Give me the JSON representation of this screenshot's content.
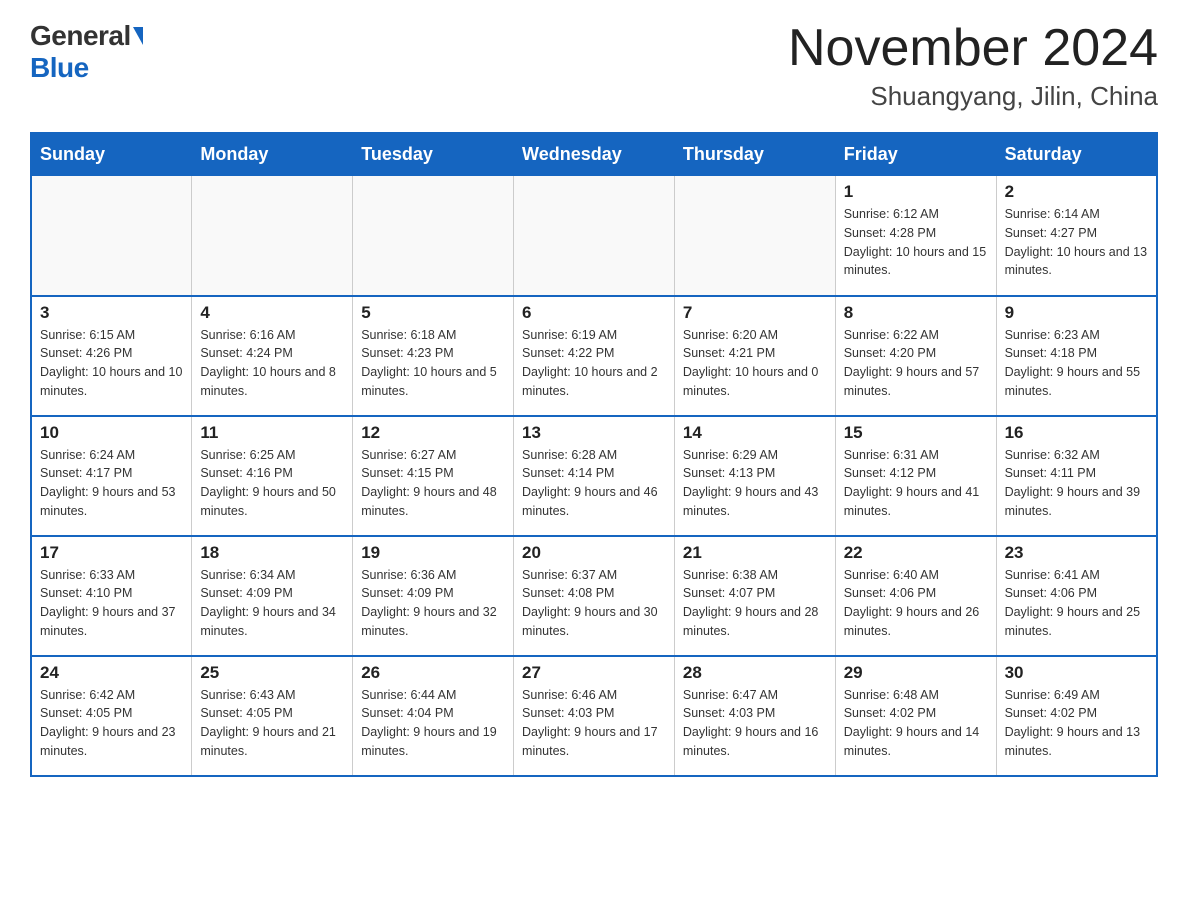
{
  "header": {
    "logo_general": "General",
    "logo_blue": "Blue",
    "month_year": "November 2024",
    "location": "Shuangyang, Jilin, China"
  },
  "days_of_week": [
    "Sunday",
    "Monday",
    "Tuesday",
    "Wednesday",
    "Thursday",
    "Friday",
    "Saturday"
  ],
  "weeks": [
    [
      {
        "num": "",
        "info": ""
      },
      {
        "num": "",
        "info": ""
      },
      {
        "num": "",
        "info": ""
      },
      {
        "num": "",
        "info": ""
      },
      {
        "num": "",
        "info": ""
      },
      {
        "num": "1",
        "info": "Sunrise: 6:12 AM\nSunset: 4:28 PM\nDaylight: 10 hours and 15 minutes."
      },
      {
        "num": "2",
        "info": "Sunrise: 6:14 AM\nSunset: 4:27 PM\nDaylight: 10 hours and 13 minutes."
      }
    ],
    [
      {
        "num": "3",
        "info": "Sunrise: 6:15 AM\nSunset: 4:26 PM\nDaylight: 10 hours and 10 minutes."
      },
      {
        "num": "4",
        "info": "Sunrise: 6:16 AM\nSunset: 4:24 PM\nDaylight: 10 hours and 8 minutes."
      },
      {
        "num": "5",
        "info": "Sunrise: 6:18 AM\nSunset: 4:23 PM\nDaylight: 10 hours and 5 minutes."
      },
      {
        "num": "6",
        "info": "Sunrise: 6:19 AM\nSunset: 4:22 PM\nDaylight: 10 hours and 2 minutes."
      },
      {
        "num": "7",
        "info": "Sunrise: 6:20 AM\nSunset: 4:21 PM\nDaylight: 10 hours and 0 minutes."
      },
      {
        "num": "8",
        "info": "Sunrise: 6:22 AM\nSunset: 4:20 PM\nDaylight: 9 hours and 57 minutes."
      },
      {
        "num": "9",
        "info": "Sunrise: 6:23 AM\nSunset: 4:18 PM\nDaylight: 9 hours and 55 minutes."
      }
    ],
    [
      {
        "num": "10",
        "info": "Sunrise: 6:24 AM\nSunset: 4:17 PM\nDaylight: 9 hours and 53 minutes."
      },
      {
        "num": "11",
        "info": "Sunrise: 6:25 AM\nSunset: 4:16 PM\nDaylight: 9 hours and 50 minutes."
      },
      {
        "num": "12",
        "info": "Sunrise: 6:27 AM\nSunset: 4:15 PM\nDaylight: 9 hours and 48 minutes."
      },
      {
        "num": "13",
        "info": "Sunrise: 6:28 AM\nSunset: 4:14 PM\nDaylight: 9 hours and 46 minutes."
      },
      {
        "num": "14",
        "info": "Sunrise: 6:29 AM\nSunset: 4:13 PM\nDaylight: 9 hours and 43 minutes."
      },
      {
        "num": "15",
        "info": "Sunrise: 6:31 AM\nSunset: 4:12 PM\nDaylight: 9 hours and 41 minutes."
      },
      {
        "num": "16",
        "info": "Sunrise: 6:32 AM\nSunset: 4:11 PM\nDaylight: 9 hours and 39 minutes."
      }
    ],
    [
      {
        "num": "17",
        "info": "Sunrise: 6:33 AM\nSunset: 4:10 PM\nDaylight: 9 hours and 37 minutes."
      },
      {
        "num": "18",
        "info": "Sunrise: 6:34 AM\nSunset: 4:09 PM\nDaylight: 9 hours and 34 minutes."
      },
      {
        "num": "19",
        "info": "Sunrise: 6:36 AM\nSunset: 4:09 PM\nDaylight: 9 hours and 32 minutes."
      },
      {
        "num": "20",
        "info": "Sunrise: 6:37 AM\nSunset: 4:08 PM\nDaylight: 9 hours and 30 minutes."
      },
      {
        "num": "21",
        "info": "Sunrise: 6:38 AM\nSunset: 4:07 PM\nDaylight: 9 hours and 28 minutes."
      },
      {
        "num": "22",
        "info": "Sunrise: 6:40 AM\nSunset: 4:06 PM\nDaylight: 9 hours and 26 minutes."
      },
      {
        "num": "23",
        "info": "Sunrise: 6:41 AM\nSunset: 4:06 PM\nDaylight: 9 hours and 25 minutes."
      }
    ],
    [
      {
        "num": "24",
        "info": "Sunrise: 6:42 AM\nSunset: 4:05 PM\nDaylight: 9 hours and 23 minutes."
      },
      {
        "num": "25",
        "info": "Sunrise: 6:43 AM\nSunset: 4:05 PM\nDaylight: 9 hours and 21 minutes."
      },
      {
        "num": "26",
        "info": "Sunrise: 6:44 AM\nSunset: 4:04 PM\nDaylight: 9 hours and 19 minutes."
      },
      {
        "num": "27",
        "info": "Sunrise: 6:46 AM\nSunset: 4:03 PM\nDaylight: 9 hours and 17 minutes."
      },
      {
        "num": "28",
        "info": "Sunrise: 6:47 AM\nSunset: 4:03 PM\nDaylight: 9 hours and 16 minutes."
      },
      {
        "num": "29",
        "info": "Sunrise: 6:48 AM\nSunset: 4:02 PM\nDaylight: 9 hours and 14 minutes."
      },
      {
        "num": "30",
        "info": "Sunrise: 6:49 AM\nSunset: 4:02 PM\nDaylight: 9 hours and 13 minutes."
      }
    ]
  ]
}
